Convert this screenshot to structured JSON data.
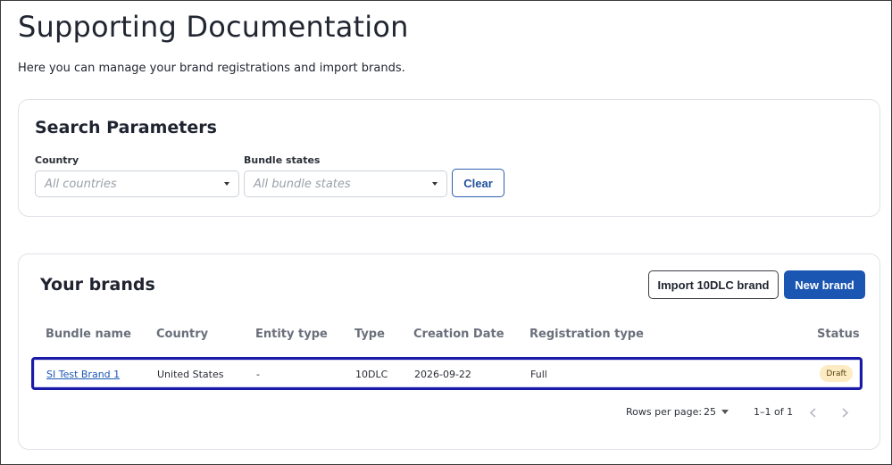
{
  "header": {
    "title": "Supporting Documentation",
    "subtitle": "Here you can manage your brand registrations and import brands."
  },
  "search": {
    "title": "Search Parameters",
    "country_label": "Country",
    "country_value": "All countries",
    "bundle_label": "Bundle states",
    "bundle_value": "All bundle states",
    "clear_label": "Clear"
  },
  "brands": {
    "title": "Your brands",
    "import_label": "Import 10DLC brand",
    "new_label": "New brand",
    "columns": [
      "Bundle name",
      "Country",
      "Entity type",
      "Type",
      "Creation Date",
      "Registration type",
      "Status"
    ],
    "rows": [
      {
        "bundle_name": "SI Test Brand 1",
        "country": "United States",
        "entity_type": "-",
        "type": "10DLC",
        "creation_date": "2026-09-22",
        "registration_type": "Full",
        "status": "Draft"
      }
    ],
    "pagination": {
      "rows_per_page_label": "Rows per page:",
      "rows_per_page_value": "25",
      "range": "1–1 of 1"
    }
  },
  "colors": {
    "primary": "#1b56b3",
    "highlight_border": "#1a1aa8",
    "draft_badge": "#fdecc3"
  }
}
